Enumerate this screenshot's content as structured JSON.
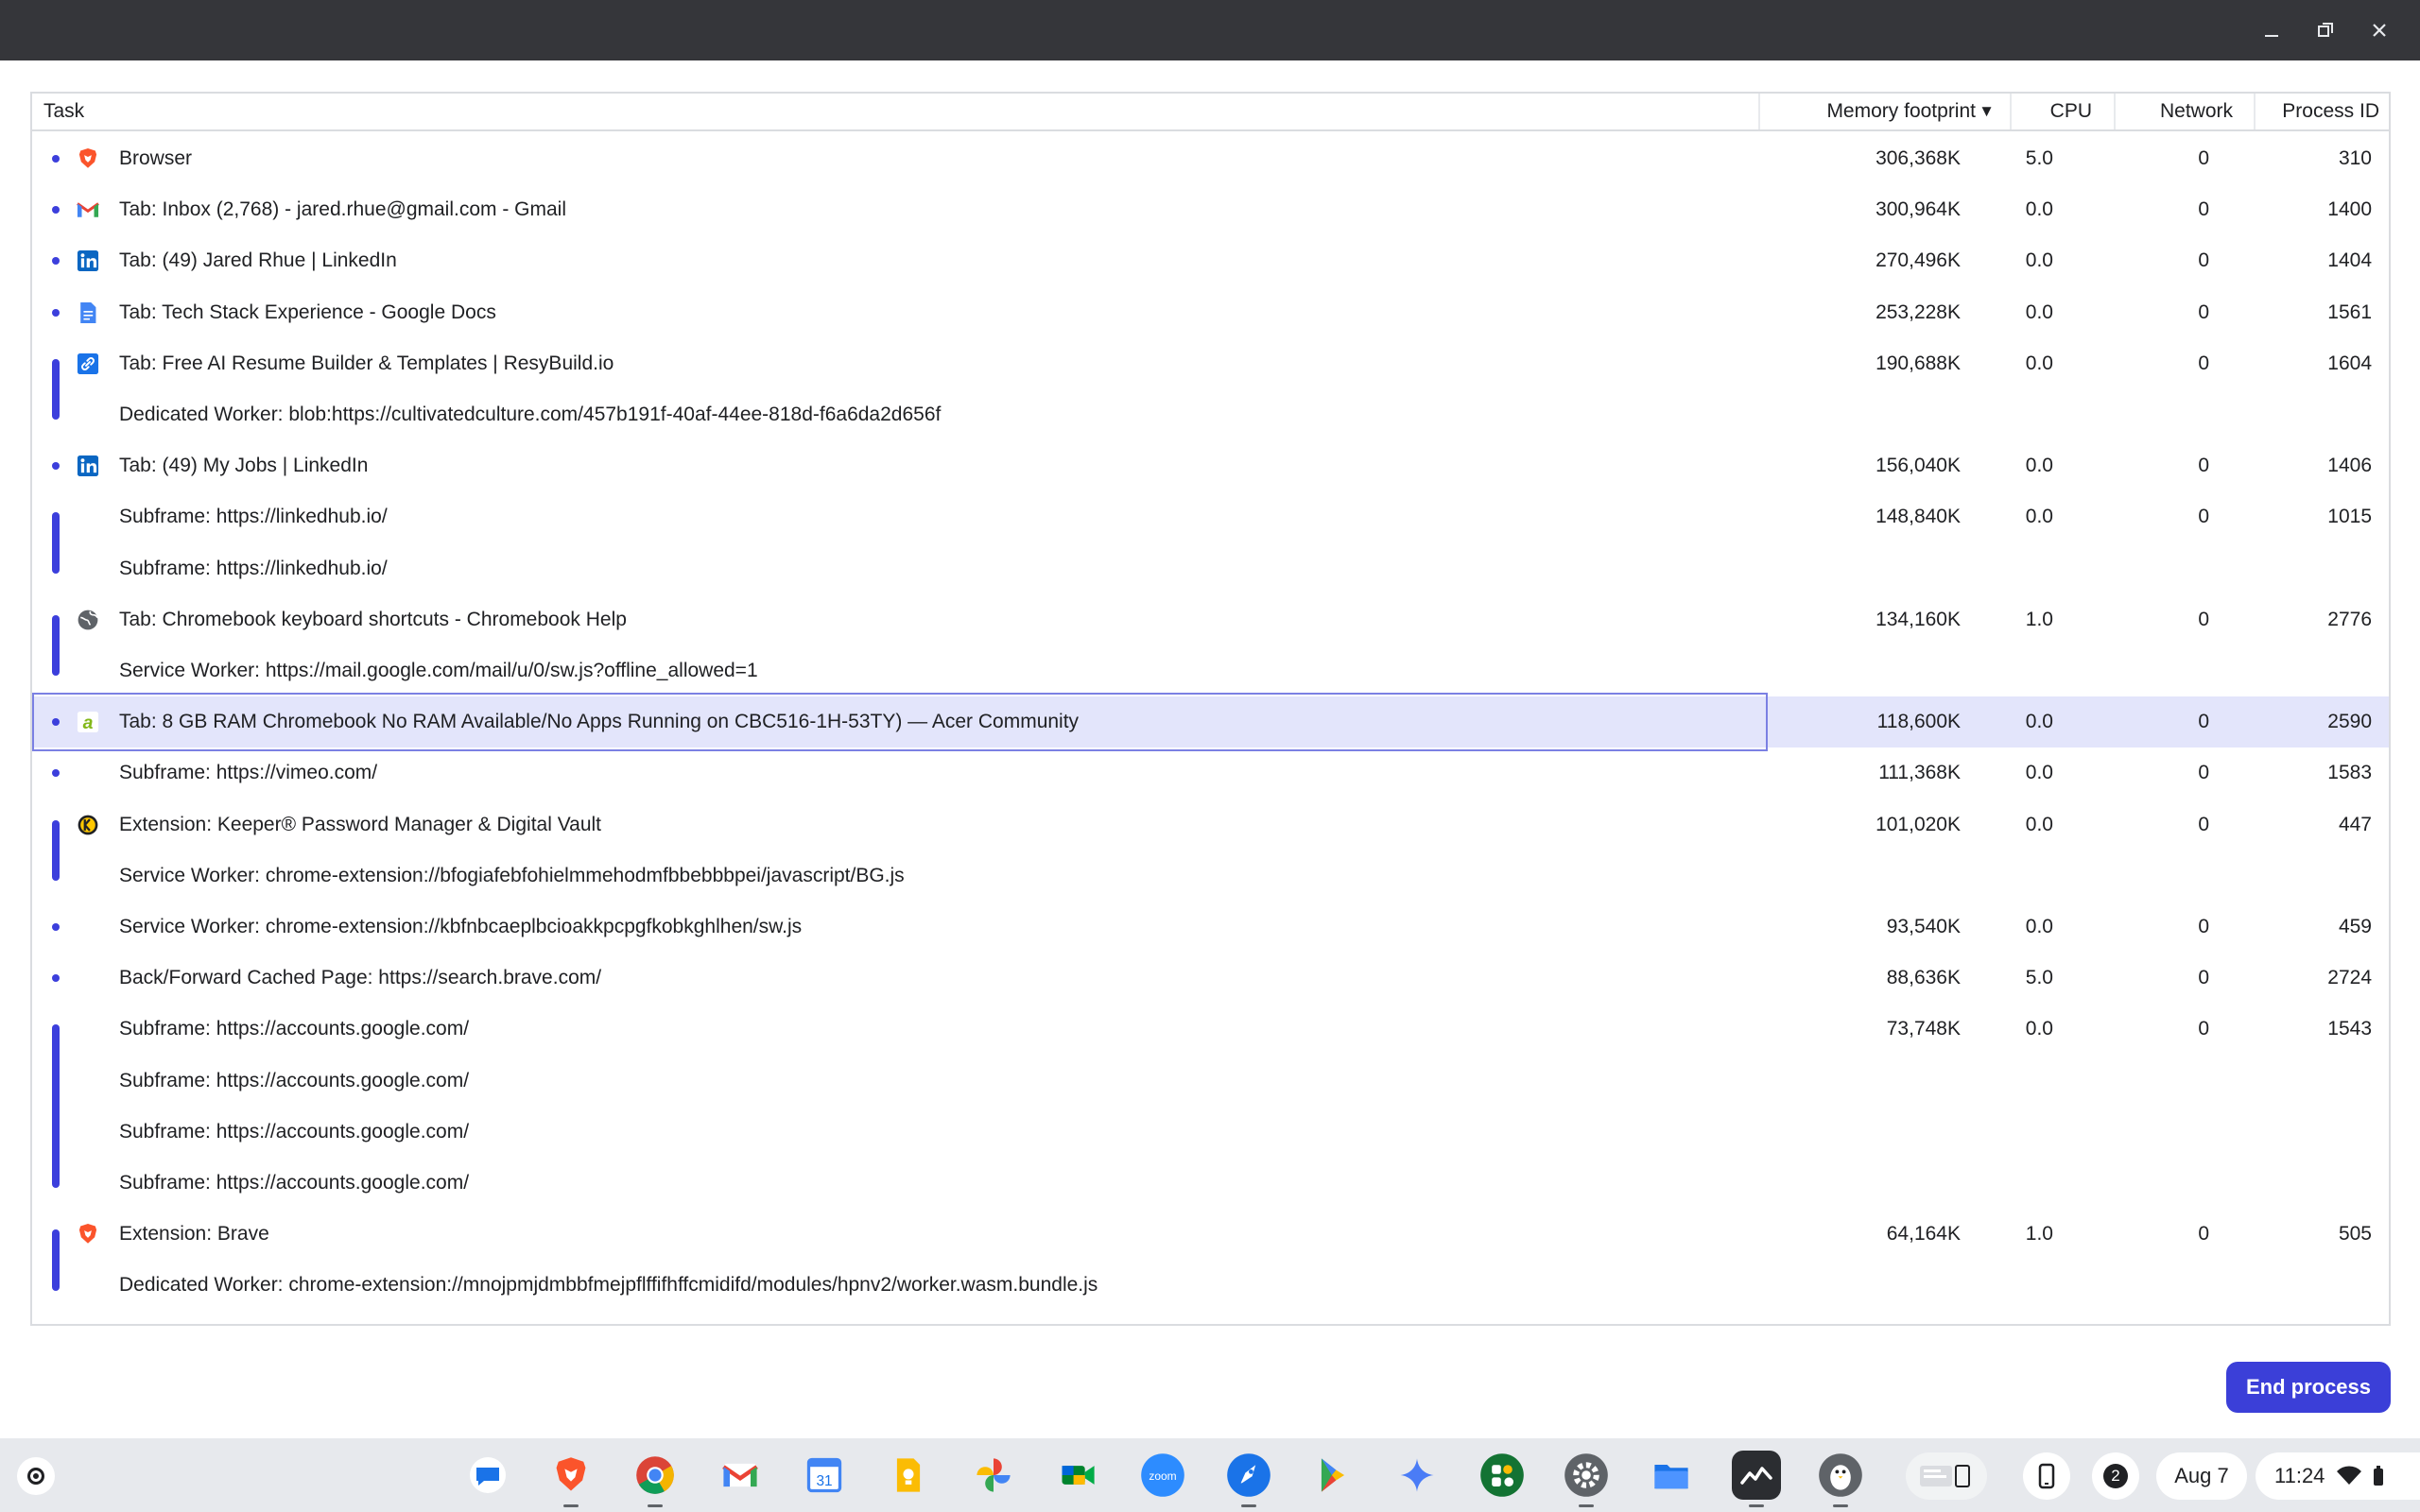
{
  "columns": {
    "task": "Task",
    "memory": "Memory footprint",
    "memory_sort": "▼",
    "cpu": "CPU",
    "network": "Network",
    "pid": "Process ID"
  },
  "rows": [
    {
      "name": "Browser",
      "mem": "306,368K",
      "cpu": "5.0",
      "net": "0",
      "pid": "310",
      "icon": "brave-icon"
    },
    {
      "name": "Tab: Inbox (2,768) - jared.rhue@gmail.com - Gmail",
      "mem": "300,964K",
      "cpu": "0.0",
      "net": "0",
      "pid": "1400",
      "icon": "gmail-icon"
    },
    {
      "name": "Tab: (49) Jared Rhue | LinkedIn",
      "mem": "270,496K",
      "cpu": "0.0",
      "net": "0",
      "pid": "1404",
      "icon": "linkedin-icon"
    },
    {
      "name": "Tab: Tech Stack Experience - Google Docs",
      "mem": "253,228K",
      "cpu": "0.0",
      "net": "0",
      "pid": "1561",
      "icon": "docs-icon"
    },
    {
      "name": "Tab: Free AI Resume Builder & Templates | ResyBuild.io",
      "mem": "190,688K",
      "cpu": "0.0",
      "net": "0",
      "pid": "1604",
      "icon": "link-icon"
    },
    {
      "name": "Dedicated Worker: blob:https://cultivatedculture.com/457b191f-40af-44ee-818d-f6a6da2d656f",
      "mem": "",
      "cpu": "",
      "net": "",
      "pid": "",
      "icon": ""
    },
    {
      "name": "Tab: (49) My Jobs | LinkedIn",
      "mem": "156,040K",
      "cpu": "0.0",
      "net": "0",
      "pid": "1406",
      "icon": "linkedin-icon"
    },
    {
      "name": "Subframe: https://linkedhub.io/",
      "mem": "148,840K",
      "cpu": "0.0",
      "net": "0",
      "pid": "1015",
      "icon": ""
    },
    {
      "name": "Subframe: https://linkedhub.io/",
      "mem": "",
      "cpu": "",
      "net": "",
      "pid": "",
      "icon": ""
    },
    {
      "name": "Tab: Chromebook keyboard shortcuts - Chromebook Help",
      "mem": "134,160K",
      "cpu": "1.0",
      "net": "0",
      "pid": "2776",
      "icon": "globe-icon"
    },
    {
      "name": "Service Worker: https://mail.google.com/mail/u/0/sw.js?offline_allowed=1",
      "mem": "",
      "cpu": "",
      "net": "",
      "pid": "",
      "icon": ""
    },
    {
      "name": "Tab: 8 GB RAM Chromebook No RAM Available/No Apps Running on CBC516-1H-53TY) — Acer Community",
      "mem": "118,600K",
      "cpu": "0.0",
      "net": "0",
      "pid": "2590",
      "icon": "acer-icon"
    },
    {
      "name": "Subframe: https://vimeo.com/",
      "mem": "111,368K",
      "cpu": "0.0",
      "net": "0",
      "pid": "1583",
      "icon": ""
    },
    {
      "name": "Extension: Keeper® Password Manager & Digital Vault",
      "mem": "101,020K",
      "cpu": "0.0",
      "net": "0",
      "pid": "447",
      "icon": "keeper-icon"
    },
    {
      "name": "Service Worker: chrome-extension://bfogiafebfohielmmehodmfbbebbbpei/javascript/BG.js",
      "mem": "",
      "cpu": "",
      "net": "",
      "pid": "",
      "icon": ""
    },
    {
      "name": "Service Worker: chrome-extension://kbfnbcaeplbcioakkpcpgfkobkghlhen/sw.js",
      "mem": "93,540K",
      "cpu": "0.0",
      "net": "0",
      "pid": "459",
      "icon": ""
    },
    {
      "name": "Back/Forward Cached Page: https://search.brave.com/",
      "mem": "88,636K",
      "cpu": "5.0",
      "net": "0",
      "pid": "2724",
      "icon": ""
    },
    {
      "name": "Subframe: https://accounts.google.com/",
      "mem": "73,748K",
      "cpu": "0.0",
      "net": "0",
      "pid": "1543",
      "icon": ""
    },
    {
      "name": "Subframe: https://accounts.google.com/",
      "mem": "",
      "cpu": "",
      "net": "",
      "pid": "",
      "icon": ""
    },
    {
      "name": "Subframe: https://accounts.google.com/",
      "mem": "",
      "cpu": "",
      "net": "",
      "pid": "",
      "icon": ""
    },
    {
      "name": "Subframe: https://accounts.google.com/",
      "mem": "",
      "cpu": "",
      "net": "",
      "pid": "",
      "icon": ""
    },
    {
      "name": "Extension: Brave",
      "mem": "64,164K",
      "cpu": "1.0",
      "net": "0",
      "pid": "505",
      "icon": "brave-icon"
    },
    {
      "name": "Dedicated Worker: chrome-extension://mnojpmjdmbbfmejpflffifhffcmidifd/modules/hpnv2/worker.wasm.bundle.js",
      "mem": "",
      "cpu": "",
      "net": "",
      "pid": "",
      "icon": ""
    }
  ],
  "selected_row": 11,
  "end_process_label": "End process",
  "shelf": {
    "date": "Aug 7",
    "time": "11:24",
    "notification_count": "2",
    "zoom_label": "zoom",
    "calendar_day": "31"
  },
  "colors": {
    "accent": "#3c3fdc",
    "selected_bg": "#e3e5fb",
    "titlebar": "#35363a",
    "shelf": "#e7e9ed"
  }
}
